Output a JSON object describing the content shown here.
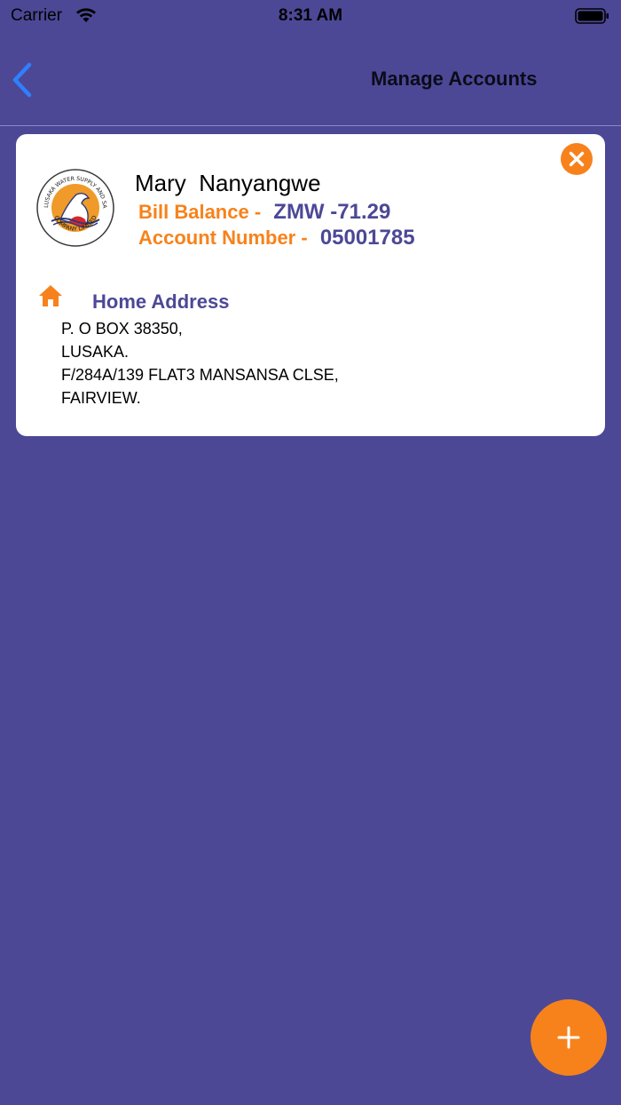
{
  "status_bar": {
    "carrier": "Carrier",
    "time": "8:31 AM"
  },
  "nav": {
    "title": "Manage Accounts",
    "back_icon": "chevron-left-icon"
  },
  "account": {
    "name": "Mary  Nanyangwe",
    "bill_balance_label": "Bill Balance -",
    "bill_balance_value": "ZMW -71.29",
    "account_number_label": "Account Number -",
    "account_number_value": "05001785",
    "address_heading": "Home Address",
    "address_lines": [
      "P. O BOX 38350,",
      "LUSAKA.",
      "F/284A/139 FLAT3 MANSANSA CLSE,",
      "FAIRVIEW."
    ],
    "logo_text_top": "LUSAKA WATER SUPPLY AND SANITATION",
    "logo_text_bottom": "COMPANY LIMITED"
  },
  "colors": {
    "background": "#4c4896",
    "accent": "#f7821b",
    "card": "#ffffff",
    "back_icon": "#2f80ff"
  },
  "icons": {
    "remove": "close-icon",
    "home": "home-icon",
    "add": "plus-icon",
    "wifi": "wifi-icon",
    "battery": "battery-icon"
  }
}
